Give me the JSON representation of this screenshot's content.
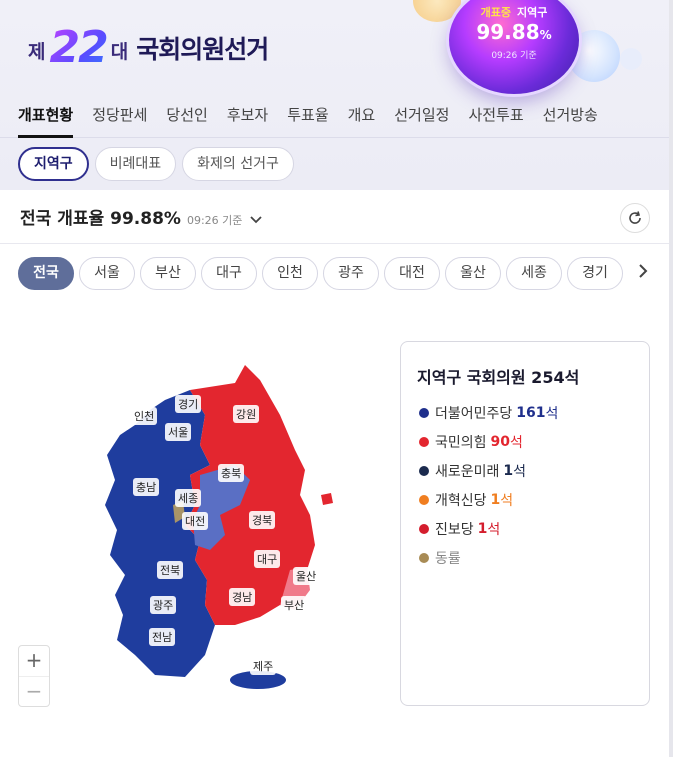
{
  "header": {
    "brand_prefix": "제",
    "brand_number": "22",
    "brand_suffix": "대",
    "brand_title": "국회의원선거",
    "badge": {
      "status_live": "개표중",
      "status_scope": "지역구",
      "percent": "99.88",
      "percent_unit": "%",
      "time": "09:26 기준"
    }
  },
  "nav": {
    "items": [
      {
        "label": "개표현황",
        "active": true
      },
      {
        "label": "정당판세"
      },
      {
        "label": "당선인"
      },
      {
        "label": "후보자"
      },
      {
        "label": "투표율"
      },
      {
        "label": "개요"
      },
      {
        "label": "선거일정"
      },
      {
        "label": "사전투표"
      },
      {
        "label": "선거방송"
      }
    ]
  },
  "subtabs": [
    {
      "label": "지역구",
      "active": true
    },
    {
      "label": "비례대표"
    },
    {
      "label": "화제의 선거구"
    }
  ],
  "rate": {
    "label": "전국 개표율",
    "value": "99.88",
    "unit": "%",
    "time": "09:26 기준",
    "chevron_icon": "chevron-down-icon",
    "refresh_icon": "refresh-icon"
  },
  "regions": {
    "items": [
      {
        "label": "전국",
        "active": true
      },
      {
        "label": "서울"
      },
      {
        "label": "부산"
      },
      {
        "label": "대구"
      },
      {
        "label": "인천"
      },
      {
        "label": "광주"
      },
      {
        "label": "대전"
      },
      {
        "label": "울산"
      },
      {
        "label": "세종"
      },
      {
        "label": "경기"
      }
    ],
    "next_icon": "chevron-right-icon"
  },
  "map": {
    "labels": [
      "인천",
      "경기",
      "서울",
      "강원",
      "충북",
      "충남",
      "세종",
      "대전",
      "경북",
      "대구",
      "전북",
      "울산",
      "광주",
      "부산",
      "경남",
      "전남",
      "제주"
    ],
    "colors": {
      "blue": "#1f3d9e",
      "red": "#e3262f",
      "light_blue": "#5a6fc4",
      "pink": "#f07a8a",
      "sejong": "#a89468"
    }
  },
  "zoom": {
    "in": "+",
    "out": "−"
  },
  "legend": {
    "title": "지역구 국회의원 254석",
    "parties": [
      {
        "name": "더불어민주당",
        "seats": "161",
        "unit": "석",
        "color": "#1f2f8c"
      },
      {
        "name": "국민의힘",
        "seats": "90",
        "unit": "석",
        "color": "#e3262f"
      },
      {
        "name": "새로운미래",
        "seats": "1",
        "unit": "석",
        "color": "#1b2a4e"
      },
      {
        "name": "개혁신당",
        "seats": "1",
        "unit": "석",
        "color": "#f07e20"
      },
      {
        "name": "진보당",
        "seats": "1",
        "unit": "석",
        "color": "#d41d2d"
      },
      {
        "name": "동률",
        "seats": "",
        "unit": "",
        "color": "#a88b55"
      }
    ]
  }
}
